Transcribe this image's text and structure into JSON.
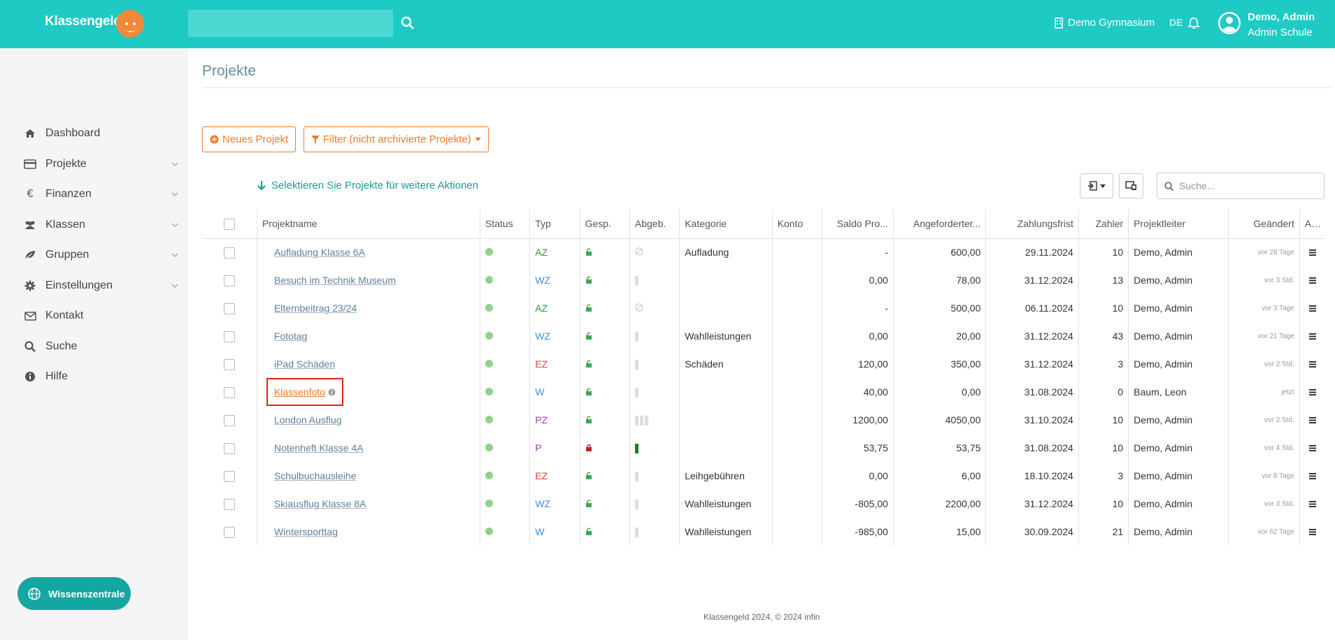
{
  "header": {
    "brand": "Klassengeld",
    "school": "Demo Gymnasium",
    "lang": "DE",
    "user_name": "Demo, Admin",
    "user_school": "Admin Schule"
  },
  "sidebar": {
    "items": [
      {
        "label": "Dashboard",
        "icon": "home-icon",
        "expandable": false
      },
      {
        "label": "Projekte",
        "icon": "card-icon",
        "expandable": true
      },
      {
        "label": "Finanzen",
        "icon": "euro-icon",
        "expandable": true
      },
      {
        "label": "Klassen",
        "icon": "users-icon",
        "expandable": true
      },
      {
        "label": "Gruppen",
        "icon": "leaf-icon",
        "expandable": true
      },
      {
        "label": "Einstellungen",
        "icon": "gear-icon",
        "expandable": true
      },
      {
        "label": "Kontakt",
        "icon": "envelope-icon",
        "expandable": false
      },
      {
        "label": "Suche",
        "icon": "search-icon",
        "expandable": false
      },
      {
        "label": "Hilfe",
        "icon": "info-icon",
        "expandable": false
      }
    ],
    "wissen_label": "Wissenszentrale"
  },
  "main": {
    "title": "Projekte",
    "new_project_label": "Neues Projekt",
    "filter_label": "Filter (nicht archivierte Projekte)",
    "select_hint": "Selektieren Sie Projekte für weitere Aktionen",
    "search_placeholder": "Suche..."
  },
  "table": {
    "headers": {
      "name": "Projektname",
      "status": "Status",
      "typ": "Typ",
      "gesp": "Gesp.",
      "abgeb": "Abgeb.",
      "kategorie": "Kategorie",
      "konto": "Konto",
      "saldo": "Saldo Pro...",
      "angefordert": "Angeforderter...",
      "frist": "Zahlungsfrist",
      "zahler": "Zahler",
      "leiter": "Projektleiter",
      "geaendert": "Geändert",
      "akt": "Akt."
    },
    "rows": [
      {
        "name": "Aufladung Klasse 6A",
        "typ": "AZ",
        "typ_color": "#2e9e3e",
        "locked": false,
        "abgeb": "none",
        "kategorie": "Aufladung",
        "saldo": "-",
        "angefordert": "600,00",
        "frist": "29.11.2024",
        "zahler": "10",
        "leiter": "Demo, Admin",
        "geaendert": "vor 28 Tage"
      },
      {
        "name": "Besuch im Technik Museum",
        "typ": "WZ",
        "typ_color": "#3a8fd9",
        "locked": false,
        "abgeb": "1",
        "kategorie": "",
        "saldo": "0,00",
        "angefordert": "78,00",
        "frist": "31.12.2024",
        "zahler": "13",
        "leiter": "Demo, Admin",
        "geaendert": "vor 3 Std."
      },
      {
        "name": "Elternbeitrag 23/24",
        "typ": "AZ",
        "typ_color": "#2e9e3e",
        "locked": false,
        "abgeb": "none",
        "kategorie": "",
        "saldo": "-",
        "angefordert": "500,00",
        "frist": "06.11.2024",
        "zahler": "10",
        "leiter": "Demo, Admin",
        "geaendert": "vor 3 Tage"
      },
      {
        "name": "Fototag",
        "typ": "WZ",
        "typ_color": "#3a8fd9",
        "locked": false,
        "abgeb": "1",
        "kategorie": "Wahlleistungen",
        "saldo": "0,00",
        "angefordert": "20,00",
        "frist": "31.12.2024",
        "zahler": "43",
        "leiter": "Demo, Admin",
        "geaendert": "vor 21 Tage"
      },
      {
        "name": "iPad Schäden",
        "typ": "EZ",
        "typ_color": "#e0413a",
        "locked": false,
        "abgeb": "1",
        "kategorie": "Schäden",
        "saldo": "120,00",
        "angefordert": "350,00",
        "frist": "31.12.2024",
        "zahler": "3",
        "leiter": "Demo, Admin",
        "geaendert": "vor 2 Std."
      },
      {
        "name": "Klassenfoto",
        "typ": "W",
        "typ_color": "#3a8fd9",
        "locked": false,
        "abgeb": "1",
        "kategorie": "",
        "saldo": "40,00",
        "angefordert": "0,00",
        "frist": "31.08.2024",
        "zahler": "0",
        "leiter": "Baum, Leon",
        "geaendert": "jetzt",
        "highlight": true
      },
      {
        "name": "London Ausflug",
        "typ": "PZ",
        "typ_color": "#a43bb5",
        "locked": false,
        "abgeb": "3",
        "kategorie": "",
        "saldo": "1200,00",
        "angefordert": "4050,00",
        "frist": "31.10.2024",
        "zahler": "10",
        "leiter": "Demo, Admin",
        "geaendert": "vor 2 Std."
      },
      {
        "name": "Notenheft Klasse 4A",
        "typ": "P",
        "typ_color": "#a43bb5",
        "locked": true,
        "abgeb": "green",
        "kategorie": "",
        "saldo": "53,75",
        "angefordert": "53,75",
        "frist": "31.08.2024",
        "zahler": "10",
        "leiter": "Demo, Admin",
        "geaendert": "vor 4 Std."
      },
      {
        "name": "Schulbuchausleihe",
        "typ": "EZ",
        "typ_color": "#e0413a",
        "locked": false,
        "abgeb": "1",
        "kategorie": "Leihgebühren",
        "saldo": "0,00",
        "angefordert": "6,00",
        "frist": "18.10.2024",
        "zahler": "3",
        "leiter": "Demo, Admin",
        "geaendert": "vor 8 Tage"
      },
      {
        "name": "Skiausflug Klasse 8A",
        "typ": "WZ",
        "typ_color": "#3a8fd9",
        "locked": false,
        "abgeb": "1",
        "kategorie": "Wahlleistungen",
        "saldo": "-805,00",
        "angefordert": "2200,00",
        "frist": "31.12.2024",
        "zahler": "10",
        "leiter": "Demo, Admin",
        "geaendert": "vor 3 Std."
      },
      {
        "name": "Wintersporttag",
        "typ": "W",
        "typ_color": "#3a8fd9",
        "locked": false,
        "abgeb": "1",
        "kategorie": "Wahlleistungen",
        "saldo": "-985,00",
        "angefordert": "15,00",
        "frist": "30.09.2024",
        "zahler": "21",
        "leiter": "Demo, Admin",
        "geaendert": "vor 62 Tage"
      }
    ]
  },
  "footer": "Klassengeld 2024, © 2024 infin",
  "colors": {
    "teal": "#1ecac4",
    "orange": "#f07a2a",
    "highlight": "#e3201c"
  }
}
